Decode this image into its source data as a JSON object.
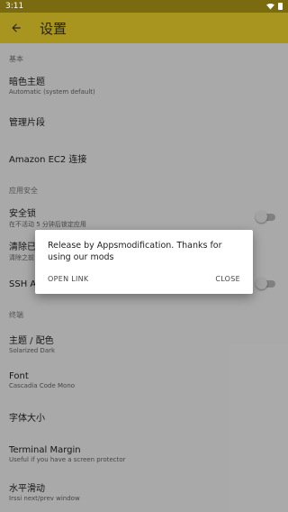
{
  "status_bar": {
    "time": "3:11"
  },
  "toolbar": {
    "title": "设置"
  },
  "list": [
    {
      "type": "section",
      "title": "基本"
    },
    {
      "type": "item",
      "title": "暗色主题",
      "subtitle": "Automatic (system default)",
      "h": 40
    },
    {
      "type": "item",
      "title": "管理片段",
      "h": 41
    },
    {
      "type": "item",
      "title": "Amazon EC2 连接",
      "h": 41
    },
    {
      "type": "section",
      "title": "应用安全"
    },
    {
      "type": "item",
      "title": "安全锁",
      "subtitle": "在不活动 5 分钟后锁定应用",
      "toggle": true,
      "h": 38
    },
    {
      "type": "item",
      "title": "清除已",
      "subtitle": "清除之前",
      "h": 36
    },
    {
      "type": "item",
      "title": "SSH Ag",
      "toggle": true,
      "h": 38
    },
    {
      "type": "section",
      "title": "终端"
    },
    {
      "type": "item",
      "title": "主题 / 配色",
      "subtitle": "Solarized Dark",
      "h": 41
    },
    {
      "type": "item",
      "title": "Font",
      "subtitle": "Cascadia Code Mono",
      "h": 41
    },
    {
      "type": "item",
      "title": "字体大小",
      "h": 41
    },
    {
      "type": "item",
      "title": "Terminal Margin",
      "subtitle": "Useful if you have a screen protector",
      "h": 41
    },
    {
      "type": "item",
      "title": "水平滑动",
      "subtitle": "Irssi next/prev window",
      "h": 41
    }
  ],
  "dialog": {
    "message": "Release by Appsmodification. Thanks for using our mods",
    "open_link": "OPEN LINK",
    "close": "CLOSE"
  },
  "colors": {
    "accent": "#f7dc2f",
    "status_bar": "#7a6a10"
  }
}
